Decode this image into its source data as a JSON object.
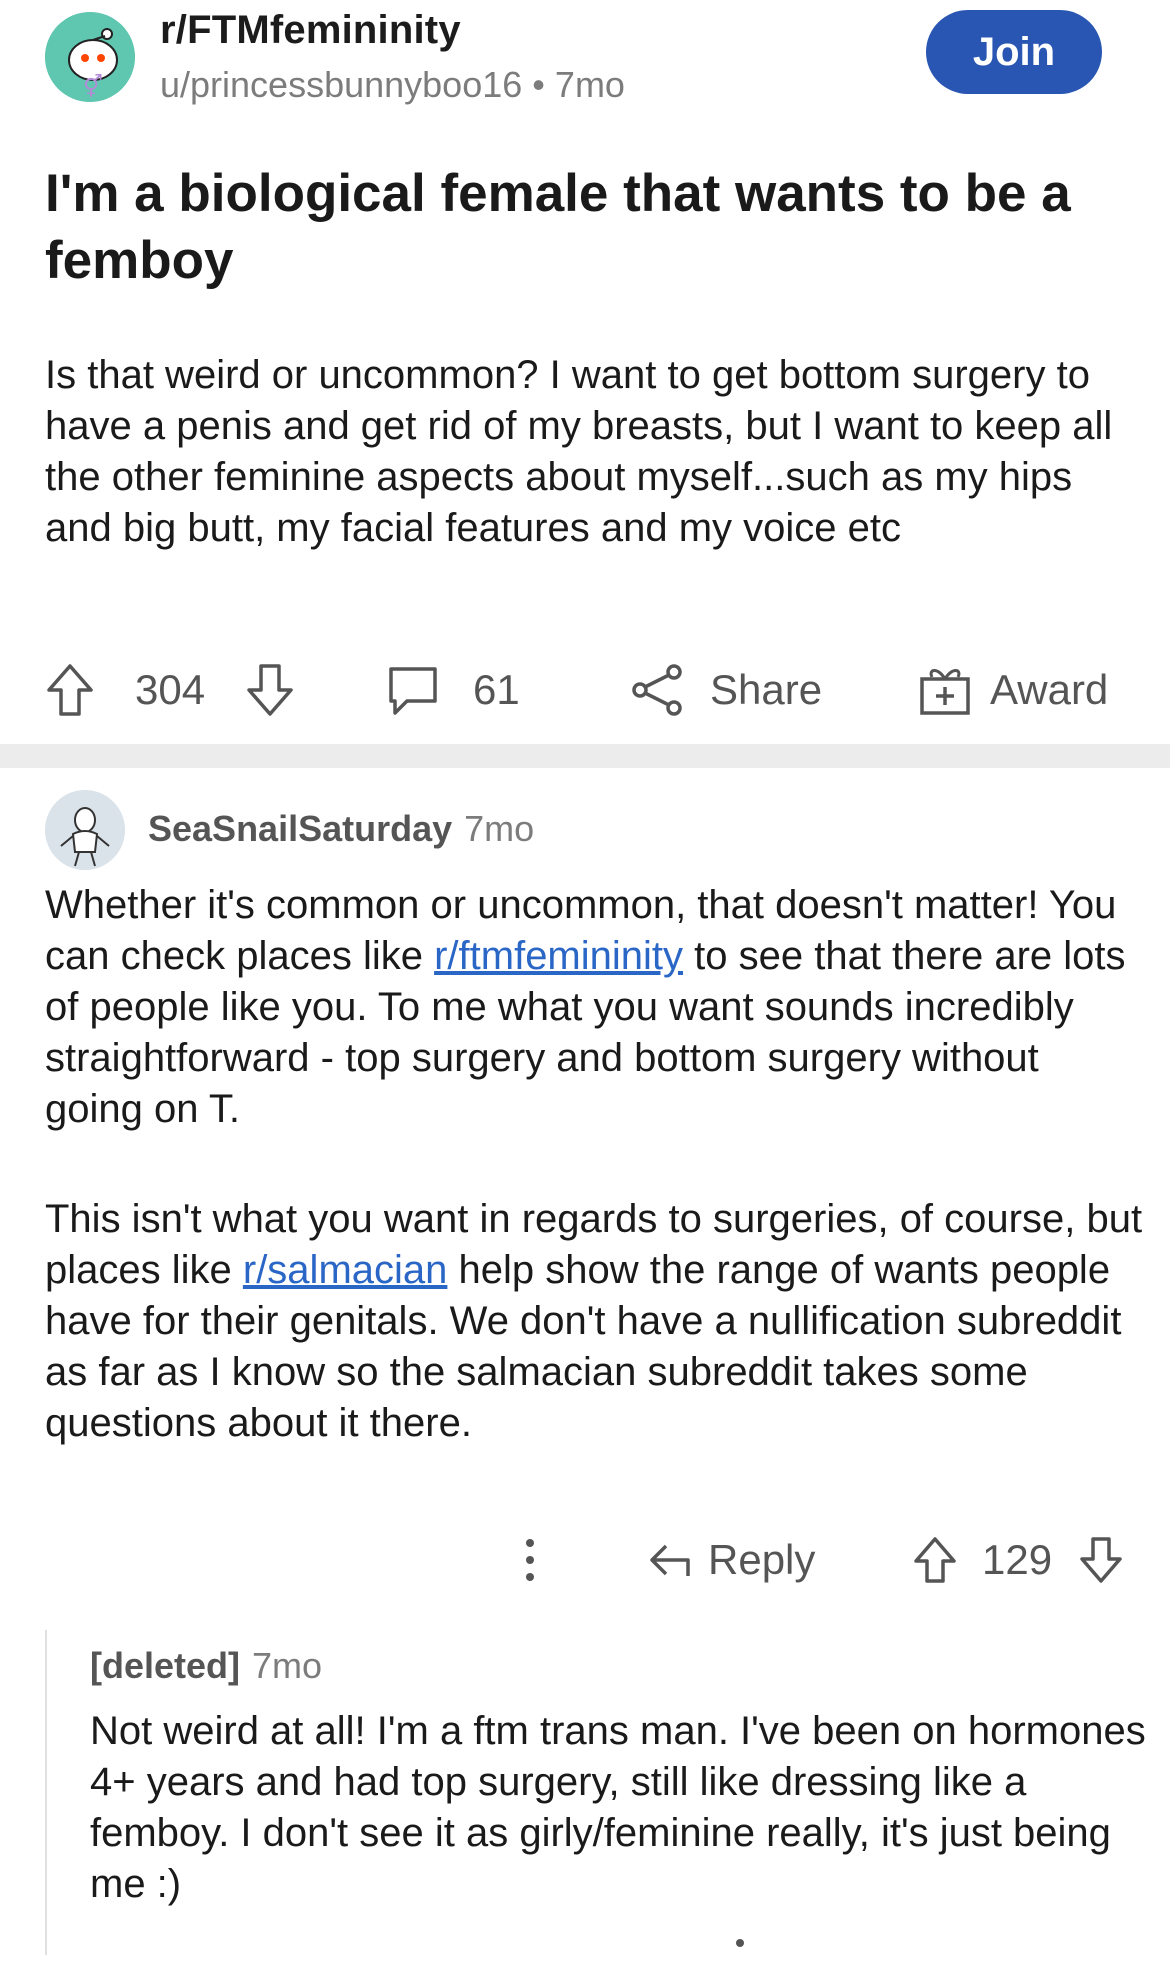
{
  "post": {
    "subreddit": "r/FTMfemininity",
    "author": "u/princessbunnyboo16",
    "separator": "•",
    "age": "7mo",
    "join_label": "Join",
    "title": "I'm a biological female that wants to be a femboy",
    "body": "Is that weird or uncommon? I want to get bottom surgery to have a penis and get rid of my breasts, but I want to keep all the other feminine aspects about myself...such as my hips and big butt, my facial features and my voice etc",
    "upvotes": "304",
    "comments": "61",
    "share_label": "Share",
    "award_label": "Award"
  },
  "comment": {
    "author": "SeaSnailSaturday",
    "age": "7mo",
    "p1_a": "Whether it's common or uncommon, that doesn't matter! You can check places like ",
    "p1_link": "r/ftmfemininity",
    "p1_b": " to see that there are lots of people like you. To me what you want sounds incredibly straightforward - top surgery and bottom surgery without going on T.",
    "p2_a": "This isn't what you want in regards to surgeries, of course, but places like ",
    "p2_link": "r/salmacian",
    "p2_b": " help show the range of wants people have for their genitals. We don't have a nullification subreddit as far as I know so  the salmacian subreddit takes some questions about it there.",
    "reply_label": "Reply",
    "votes": "129"
  },
  "reply": {
    "author": "[deleted]",
    "age": "7mo",
    "body": "Not weird at all! I'm a ftm trans man. I've been on hormones 4+ years and had top surgery, still like dressing like a femboy. I don't see it as girly/feminine really, it's just being me :)"
  },
  "colors": {
    "join": "#2a56b3",
    "link": "#2a66c6",
    "subreddit_icon": "#5fc6b0"
  }
}
